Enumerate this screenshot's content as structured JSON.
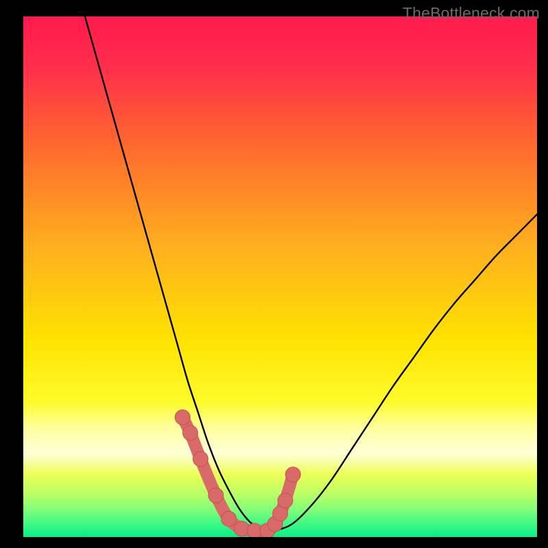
{
  "watermark": "TheBottleneck.com",
  "colors": {
    "top": "#ff1a4e",
    "mid1": "#ff6a2e",
    "mid2": "#ffe200",
    "band_pale": "#ffff9e",
    "band_yellowgreen": "#ecff55",
    "band_lightgreen": "#9cff7a",
    "bottom": "#05ef88",
    "curve": "#000000",
    "marker_fill": "#d96a6a",
    "marker_stroke": "#c94f52"
  },
  "chart_data": {
    "type": "line",
    "title": "",
    "xlabel": "",
    "ylabel": "",
    "xlim": [
      0,
      100
    ],
    "ylim": [
      0,
      100
    ],
    "grid": false,
    "legend": false,
    "series": [
      {
        "name": "bottleneck-curve",
        "x": [
          12,
          14,
          16,
          18,
          20,
          22,
          24,
          26,
          28,
          30,
          32,
          34,
          36,
          38,
          40,
          42,
          44,
          46,
          48,
          52,
          56,
          60,
          64,
          68,
          72,
          76,
          80,
          84,
          88,
          92,
          96,
          100
        ],
        "y": [
          100,
          93,
          86,
          79,
          72,
          65,
          58,
          51,
          44,
          37,
          30,
          24,
          18,
          13,
          9,
          5.5,
          3,
          1.6,
          1.2,
          2.3,
          6,
          11,
          17,
          23,
          29,
          34.5,
          40,
          45,
          49.5,
          54,
          58,
          62
        ]
      },
      {
        "name": "highlight-markers",
        "x": [
          31,
          32.5,
          34.5,
          37.5,
          40,
          42.5,
          45,
          47.5,
          49,
          50,
          51,
          52.5
        ],
        "y": [
          23,
          20,
          15,
          8,
          3.5,
          1.6,
          1.2,
          1.2,
          2.5,
          4.5,
          7,
          12
        ]
      }
    ],
    "annotations": [
      {
        "text": "TheBottleneck.com",
        "position": "top-right"
      }
    ]
  }
}
